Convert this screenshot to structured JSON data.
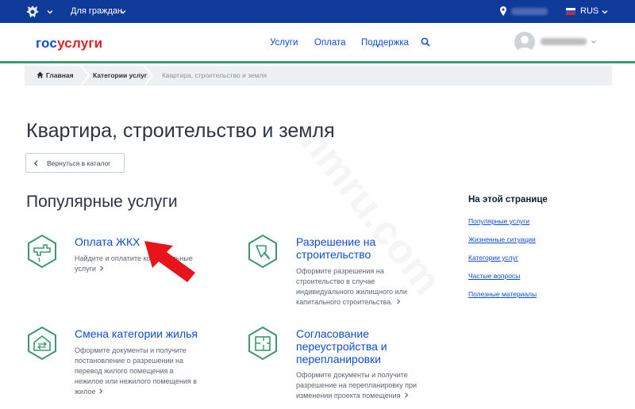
{
  "topbar": {
    "citizens_label": "Для граждан",
    "lang": "RUS"
  },
  "header": {
    "logo_part1": "гос",
    "logo_part2": "услуги",
    "nav": [
      "Услуги",
      "Оплата",
      "Поддержка"
    ]
  },
  "breadcrumb": {
    "home": "Главная",
    "categories": "Категории услуг",
    "current": "Квартира, строительство и земля"
  },
  "page": {
    "title": "Квартира, строительство и земля",
    "back_label": "Вернуться в каталог",
    "popular_heading": "Популярные услуги"
  },
  "services": [
    {
      "title_lines": [
        "Оплата ЖКХ"
      ],
      "desc_lines": [
        "Найдите и оплатите коммунальные",
        "услуги"
      ],
      "icon": "faucet-icon"
    },
    {
      "title_lines": [
        "Разрешение на",
        "строительство"
      ],
      "desc_lines": [
        "Оформите разрешения на",
        "строительство в случае",
        "индивидуального жилищного или",
        "капитального строительства."
      ],
      "icon": "trowel-icon"
    },
    {
      "title_lines": [
        "Смена категории жилья"
      ],
      "desc_lines": [
        "Оформите документы и получите",
        "постановление о разрешении на",
        "перевод жилого помещения в",
        "нежилое или нежилого помещения в",
        "жилое"
      ],
      "icon": "house-exchange-icon"
    },
    {
      "title_lines": [
        "Согласование",
        "переустройства и",
        "перепланировки"
      ],
      "desc_lines": [
        "Оформите документы и получите",
        "разрешение на перепланировку при",
        "изменении проекта помещения"
      ],
      "icon": "floorplan-icon"
    }
  ],
  "on_this_page": {
    "title": "На этой странице",
    "links": [
      "Популярные услуги",
      "Жизненные ситуации",
      "Категории услуг",
      "Частые вопросы",
      "Полезные материалы"
    ]
  },
  "watermark": "mmru.com",
  "colors": {
    "topbar": "#103a9a",
    "link": "#0d4cd3",
    "accent_green": "#3b9a6b",
    "logo_red": "#e31e24",
    "arrow_red": "#e8141c"
  }
}
